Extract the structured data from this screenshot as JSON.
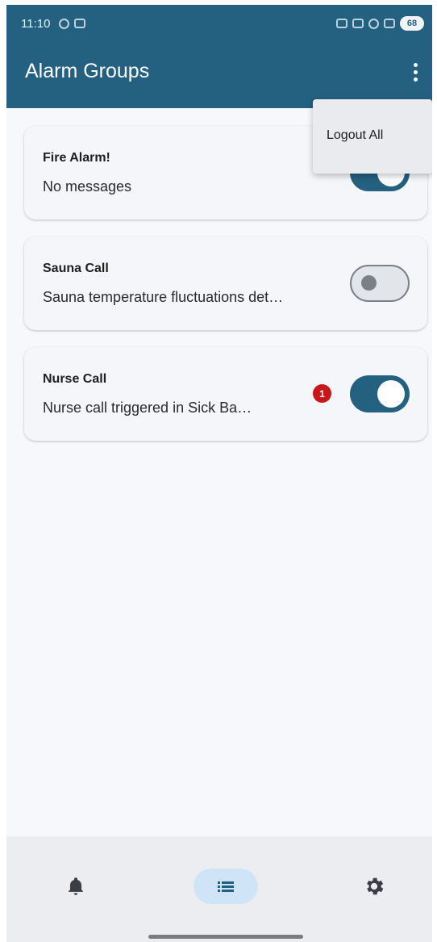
{
  "status_bar": {
    "time": "11:10",
    "battery": "68"
  },
  "app_bar": {
    "title": "Alarm Groups"
  },
  "overflow_menu": {
    "items": [
      {
        "label": "Logout All"
      }
    ]
  },
  "groups": [
    {
      "title": "Fire Alarm!",
      "subtitle": "No messages",
      "enabled": true,
      "unread": null
    },
    {
      "title": "Sauna Call",
      "subtitle": "Sauna temperature fluctuations det…",
      "enabled": false,
      "unread": null
    },
    {
      "title": "Nurse Call",
      "subtitle": "Nurse call triggered in Sick Ba…",
      "enabled": true,
      "unread": "1"
    }
  ],
  "bottom_nav": {
    "items": [
      {
        "id": "alarms",
        "icon": "bell-icon",
        "selected": false
      },
      {
        "id": "groups",
        "icon": "list-icon",
        "selected": true
      },
      {
        "id": "settings",
        "icon": "gear-icon",
        "selected": false
      }
    ]
  },
  "colors": {
    "primary": "#24607f",
    "badge": "#c8161d",
    "selected_pill": "#cfe4f6",
    "background": "#f6f8fc"
  }
}
